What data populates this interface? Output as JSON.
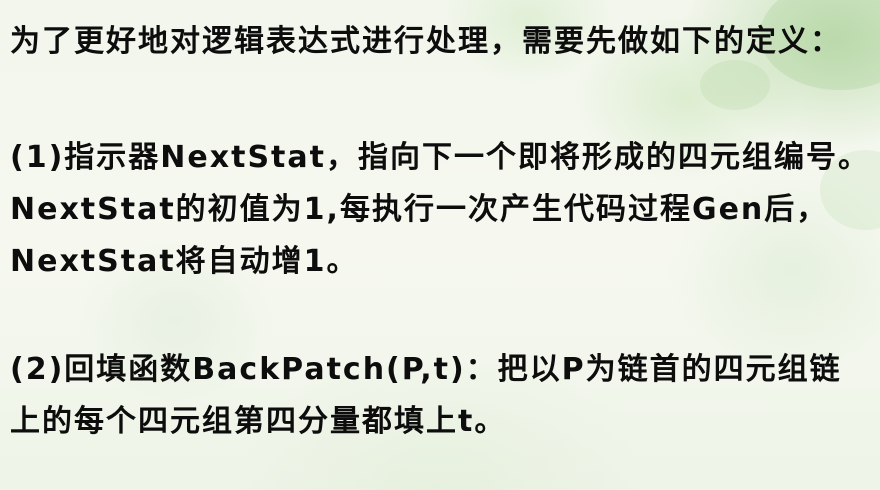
{
  "slide": {
    "paragraphs": [
      "为了更好地对逻辑表达式进行处理，需要先做如下的定义：",
      "(1)指示器NextStat，指向下一个即将形成的四元组编号。NextStat的初值为1,每执行一次产生代码过程Gen后，NextStat将自动增1。",
      "(2)回填函数BackPatch(P,t)：把以P为链首的四元组链上的每个四元组第四分量都填上t。"
    ]
  }
}
